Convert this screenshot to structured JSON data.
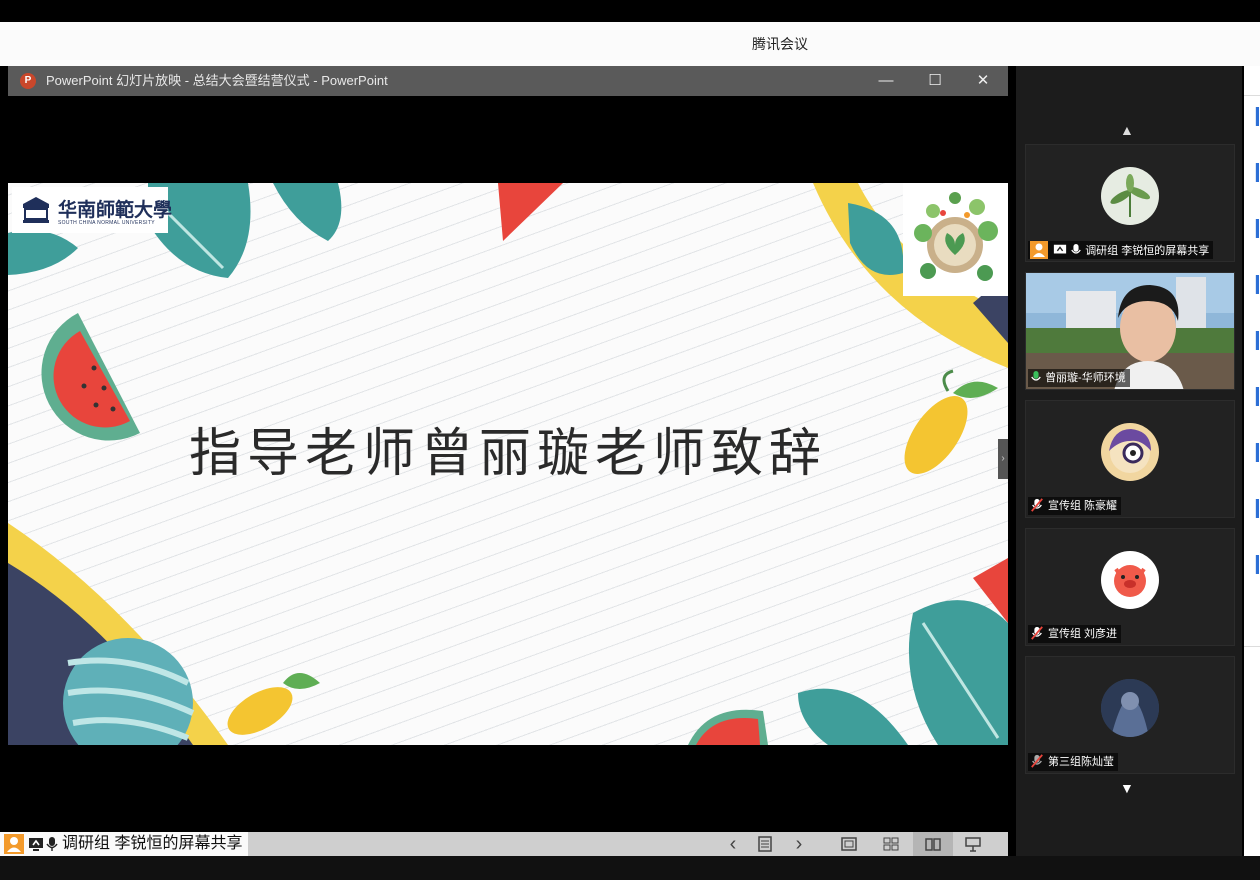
{
  "app": {
    "title": "腾讯会议"
  },
  "ppt_window": {
    "title": "PowerPoint 幻灯片放映  -  总结大会暨结营仪式 - PowerPoint",
    "minimize": "—",
    "maximize": "☐",
    "close": "✕"
  },
  "slide": {
    "title": "指导老师曾丽璇老师致辞",
    "university_name": "华南師範大學",
    "university_name_en": "SOUTH CHINA NORMAL UNIVERSITY"
  },
  "share_toolbar": {
    "label": "调研组 李锐恒的屏幕共享",
    "prev": "‹",
    "next": "›"
  },
  "participants": {
    "scroll_up": "▲",
    "scroll_down": "▼",
    "tiles": [
      {
        "label": "调研组 李锐恒的屏幕共享"
      },
      {
        "label": "曾丽璇-华师环境"
      },
      {
        "label": "宣传组 陈豪耀"
      },
      {
        "label": "宣传组 刘彦进"
      },
      {
        "label": "第三组陈灿莹"
      }
    ]
  },
  "colors": {
    "titlebar_bg": "#5a5a5a",
    "sidebar_bg": "#1c1c1c",
    "accent_orange": "#f39a2b",
    "mic_green": "#3bbf5c",
    "slide_teal": "#3f9e9a",
    "slide_yellow": "#f4d24a",
    "watermelon_red": "#e8453c"
  }
}
